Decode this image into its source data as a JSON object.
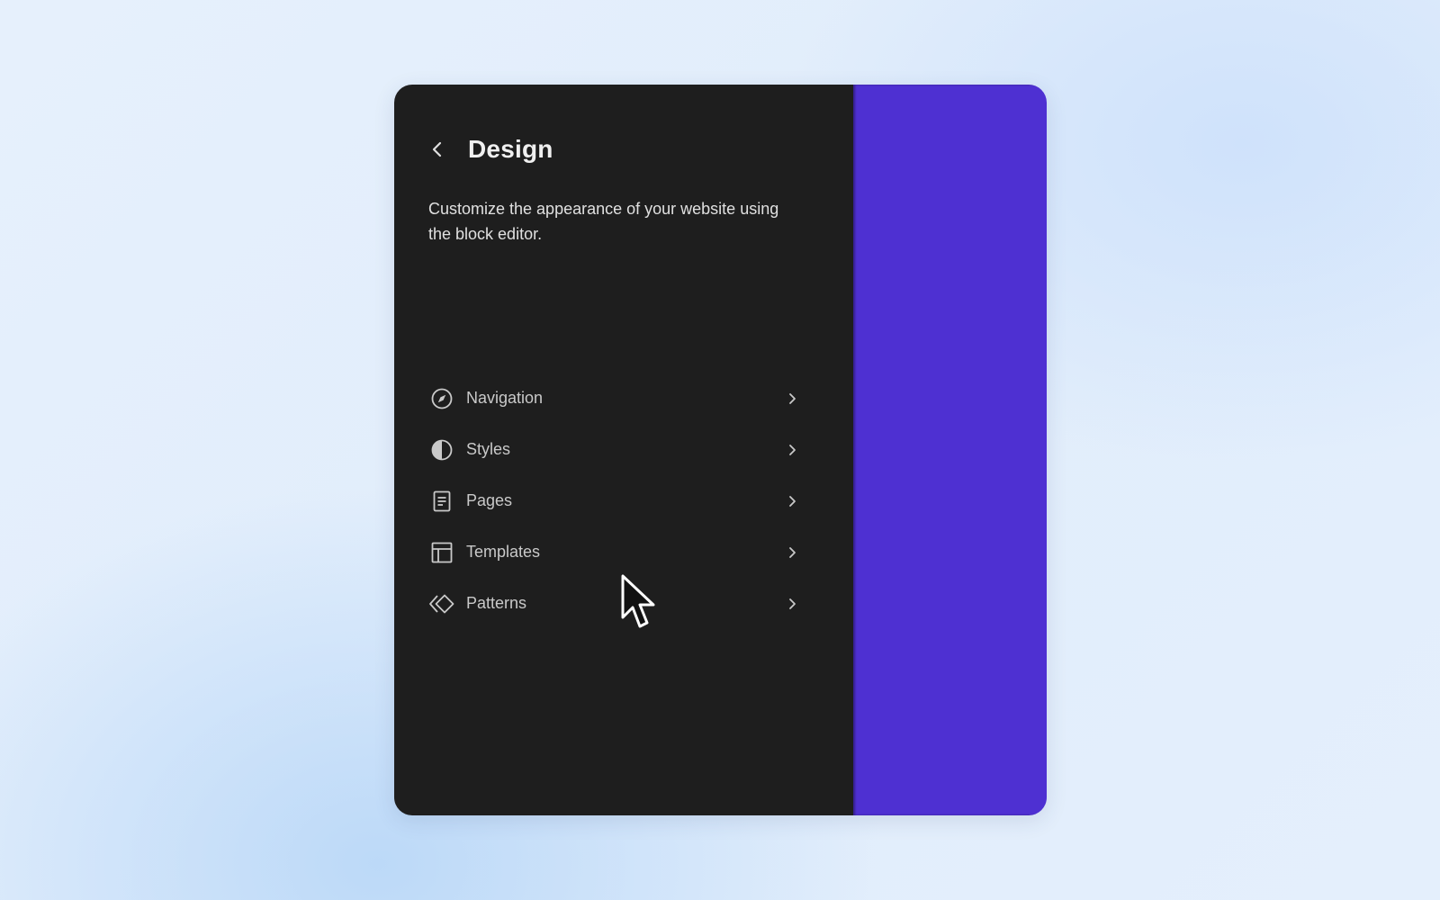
{
  "sidebar": {
    "back_icon": "chevron-left-icon",
    "title": "Design",
    "description": "Customize the appearance of your website using the block editor.",
    "items": [
      {
        "label": "Navigation",
        "icon": "compass-icon"
      },
      {
        "label": "Styles",
        "icon": "half-circle-icon"
      },
      {
        "label": "Pages",
        "icon": "page-icon"
      },
      {
        "label": "Templates",
        "icon": "layout-icon"
      },
      {
        "label": "Patterns",
        "icon": "diamond-icon"
      }
    ]
  },
  "colors": {
    "sidebar_bg": "#1e1e1e",
    "canvas_bg": "#4e30d2",
    "text_primary": "#f0f0f0",
    "text_secondary": "#c9c9c9"
  }
}
